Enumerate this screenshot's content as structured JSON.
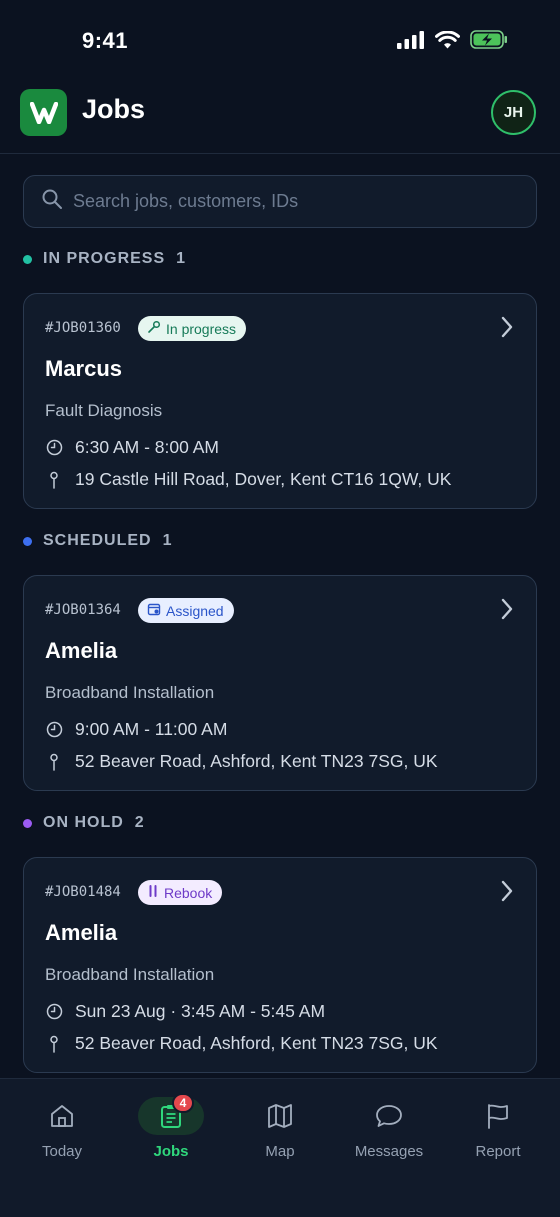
{
  "status_bar": {
    "time": "9:41"
  },
  "header": {
    "title": "Jobs",
    "avatar_initials": "JH"
  },
  "search": {
    "placeholder": "Search jobs, customers, IDs"
  },
  "sections": [
    {
      "title": "IN PROGRESS",
      "count": "1",
      "color": "#22c1a3",
      "job": {
        "id": "#JOB01360",
        "badge": "In progress",
        "customer": "Marcus",
        "service": "Fault Diagnosis",
        "time": "6:30 AM - 8:00 AM",
        "address": "19 Castle Hill Road, Dover, Kent CT16 1QW, UK"
      }
    },
    {
      "title": "SCHEDULED",
      "count": "1",
      "color": "#3d6ff0",
      "job": {
        "id": "#JOB01364",
        "badge": "Assigned",
        "customer": "Amelia",
        "service": "Broadband Installation",
        "time": "9:00 AM - 11:00 AM",
        "address": "52 Beaver Road, Ashford, Kent TN23 7SG, UK"
      }
    },
    {
      "title": "ON HOLD",
      "count": "2",
      "color": "#9b5cf2",
      "job": {
        "id": "#JOB01484",
        "badge": "Rebook",
        "customer": "Amelia",
        "service": "Broadband Installation",
        "time": "Sun 23 Aug · 3:45 AM - 5:45 AM",
        "address": "52 Beaver Road, Ashford, Kent TN23 7SG, UK"
      }
    }
  ],
  "tabbar": {
    "items": [
      {
        "label": "Today",
        "icon": "home-icon"
      },
      {
        "label": "Jobs",
        "icon": "clipboard-icon",
        "badge": "4",
        "active": true
      },
      {
        "label": "Map",
        "icon": "map-icon"
      },
      {
        "label": "Messages",
        "icon": "chat-bubble-icon"
      },
      {
        "label": "Report",
        "icon": "flag-icon"
      }
    ]
  },
  "colors": {
    "background": "#0b1220",
    "card": "#111b2b",
    "accent_green": "#2fd77c",
    "brand": "#1a8a3e"
  }
}
